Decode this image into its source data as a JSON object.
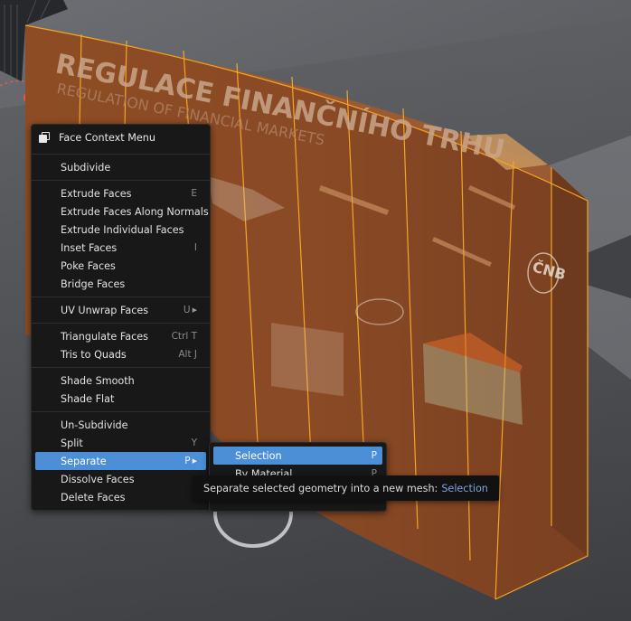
{
  "poster": {
    "title": "REGULACE FINANČNÍHO TRHU",
    "subtitle": "REGULATION OF FINANCIAL MARKETS",
    "logo_text": "ČNB"
  },
  "context_menu": {
    "title": "Face Context Menu",
    "groups": [
      [
        {
          "label": "Subdivide",
          "shortcut": ""
        }
      ],
      [
        {
          "label": "Extrude Faces",
          "shortcut": "E"
        },
        {
          "label": "Extrude Faces Along Normals",
          "shortcut": ""
        },
        {
          "label": "Extrude Individual Faces",
          "shortcut": ""
        },
        {
          "label": "Inset Faces",
          "shortcut": "I"
        },
        {
          "label": "Poke Faces",
          "shortcut": ""
        },
        {
          "label": "Bridge Faces",
          "shortcut": ""
        }
      ],
      [
        {
          "label": "UV Unwrap Faces",
          "shortcut": "U",
          "submenu": true
        }
      ],
      [
        {
          "label": "Triangulate Faces",
          "shortcut": "Ctrl T"
        },
        {
          "label": "Tris to Quads",
          "shortcut": "Alt J"
        }
      ],
      [
        {
          "label": "Shade Smooth",
          "shortcut": ""
        },
        {
          "label": "Shade Flat",
          "shortcut": ""
        }
      ],
      [
        {
          "label": "Un-Subdivide",
          "shortcut": ""
        },
        {
          "label": "Split",
          "shortcut": "Y"
        },
        {
          "label": "Separate",
          "shortcut": "P",
          "submenu": true,
          "active": true
        },
        {
          "label": "Dissolve Faces",
          "shortcut": ""
        },
        {
          "label": "Delete Faces",
          "shortcut": ""
        }
      ]
    ]
  },
  "separate_submenu": {
    "items": [
      {
        "label": "Selection",
        "shortcut": "P",
        "active": true
      },
      {
        "label": "By Material",
        "shortcut": "P"
      }
    ]
  },
  "tooltip": {
    "text": "Separate selected geometry into a new mesh:",
    "value": "Selection"
  },
  "colors": {
    "accent": "#4c8fd6",
    "menu_bg": "#181818",
    "selection_orange": "#f5a623",
    "face_fill": "#8a4a22"
  }
}
